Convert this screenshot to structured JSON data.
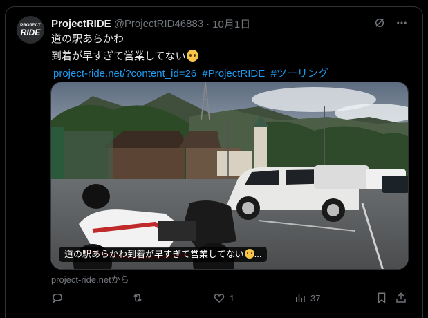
{
  "author": {
    "avatar_line1": "PROJECT",
    "avatar_line2": "RIDE",
    "name": "ProjectRIDE",
    "handle": "@ProjectRID46883",
    "separator": "·",
    "date": "10月1日"
  },
  "post": {
    "line1": "道の駅あらかわ",
    "line2": "到着が早すぎて営業してない",
    "link": "project-ride.net/?content_id=26",
    "hashtag1": "#ProjectRIDE",
    "hashtag2": "#ツーリング"
  },
  "media": {
    "caption": "道の駅あらかわ到着が早すぎて営業してない",
    "caption_ellipsis": "...",
    "source": "project-ride.netから"
  },
  "actions": {
    "reply_count": "",
    "repost_count": "",
    "like_count": "1",
    "views_count": "37"
  },
  "icons": [
    "grok-icon",
    "more-icon",
    "reply-icon",
    "repost-icon",
    "like-icon",
    "views-icon",
    "bookmark-icon",
    "share-icon"
  ],
  "colors": {
    "link": "#1d9bf0",
    "muted": "#71767b",
    "text": "#e7e9ea",
    "border": "#2f3336"
  }
}
